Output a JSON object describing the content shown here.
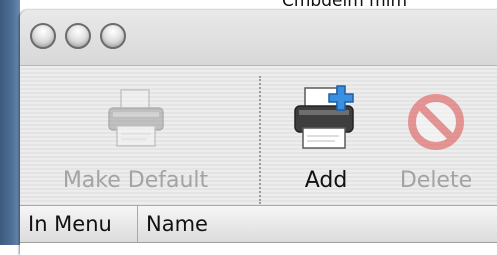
{
  "toolbar": {
    "make_default_label": "Make Default",
    "add_label": "Add",
    "delete_label": "Delete"
  },
  "table": {
    "columns": [
      "In Menu",
      "Name"
    ]
  },
  "colors": {
    "desktop_blue": "#4e7098",
    "disabled_text": "#a3a3a3",
    "window_bg": "#ececec",
    "add_badge": "#3a8fe0",
    "delete_red": "#e05a5a"
  },
  "icons": {
    "make_default": "printer-icon",
    "add": "printer-add-icon",
    "delete": "delete-forbidden-icon"
  }
}
